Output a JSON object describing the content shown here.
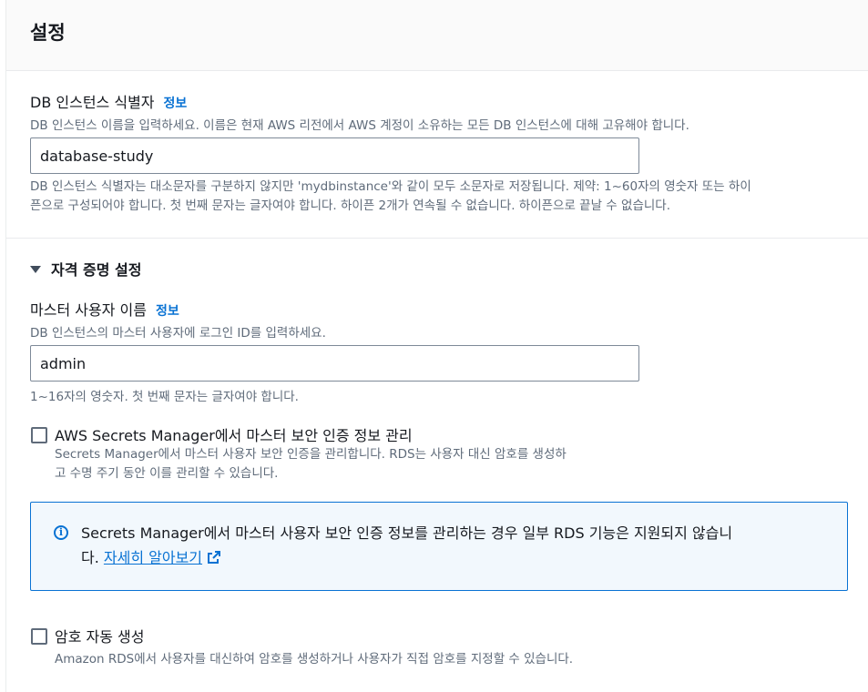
{
  "section": {
    "title": "설정"
  },
  "instance_identifier": {
    "label": "DB 인스턴스 식별자",
    "info": "정보",
    "description": "DB 인스턴스 이름을 입력하세요. 이름은 현재 AWS 리전에서 AWS 계정이 소유하는 모든 DB 인스턴스에 대해 고유해야 합니다.",
    "value": "database-study",
    "help_line1": "DB 인스턴스 식별자는 대소문자를 구분하지 않지만 'mydbinstance'와 같이 모두 소문자로 저장됩니다. 제약: 1~60자의 영숫자 또는 하이",
    "help_line2": "픈으로 구성되어야 합니다. 첫 번째 문자는 글자여야 합니다. 하이픈 2개가 연속될 수 없습니다. 하이픈으로 끝날 수 없습니다."
  },
  "credentials": {
    "expander_label": "자격 증명 설정",
    "master_username": {
      "label": "마스터 사용자 이름",
      "info": "정보",
      "description": "DB 인스턴스의 마스터 사용자에 로그인 ID를 입력하세요.",
      "value": "admin",
      "help": "1~16자의 영숫자. 첫 번째 문자는 글자여야 합니다."
    },
    "secrets_manager": {
      "label": "AWS Secrets Manager에서 마스터 보안 인증 정보 관리",
      "desc_line1": "Secrets Manager에서 마스터 사용자 보안 인증을 관리합니다. RDS는 사용자 대신 암호를 생성하",
      "desc_line2": "고 수명 주기 동안 이를 관리할 수 있습니다.",
      "checked": false
    },
    "alert": {
      "icon": "info-icon",
      "text_line1": "Secrets Manager에서 마스터 사용자 보안 인증 정보를 관리하는 경우 일부 RDS 기능은 지원되지 않습니",
      "text_line2_prefix": "다.",
      "link": "자세히 알아보기",
      "link_icon": "external-link-icon",
      "accent": "#0972d3",
      "background": "#f2f8fd"
    },
    "auto_password": {
      "label": "암호 자동 생성",
      "desc": "Amazon RDS에서 사용자를 대신하여 암호를 생성하거나 사용자가 직접 암호를 지정할 수 있습니다.",
      "checked": false
    }
  }
}
